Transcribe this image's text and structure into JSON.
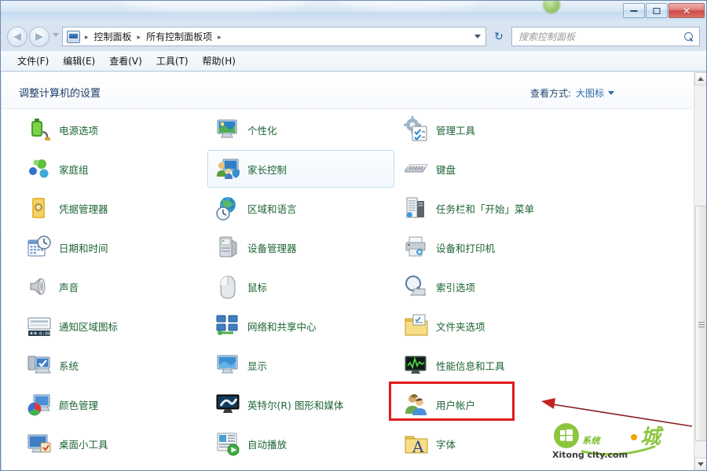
{
  "window": {
    "title": "",
    "buttons": {
      "minimize": "minimize",
      "maximize": "maximize",
      "close": "✕"
    }
  },
  "nav": {
    "back_tooltip": "后退",
    "forward_tooltip": "前进",
    "breadcrumb": [
      "控制面板",
      "所有控制面板项"
    ],
    "separator": "▸",
    "refresh_glyph": "↻",
    "address_icon": "control-panel-icon"
  },
  "search": {
    "placeholder": "搜索控制面板",
    "value": ""
  },
  "menubar": {
    "items": [
      "文件(F)",
      "编辑(E)",
      "查看(V)",
      "工具(T)",
      "帮助(H)"
    ]
  },
  "page": {
    "title": "调整计算机的设置",
    "view_by_label": "查看方式:",
    "view_by_value": "大图标"
  },
  "items": [
    {
      "label": "电源选项",
      "icon": "power-options-icon",
      "col": 0,
      "row": 0,
      "hover": false
    },
    {
      "label": "家庭组",
      "icon": "homegroup-icon",
      "col": 0,
      "row": 1,
      "hover": false
    },
    {
      "label": "凭据管理器",
      "icon": "credential-manager-icon",
      "col": 0,
      "row": 2,
      "hover": false
    },
    {
      "label": "日期和时间",
      "icon": "date-time-icon",
      "col": 0,
      "row": 3,
      "hover": false
    },
    {
      "label": "声音",
      "icon": "sound-icon",
      "col": 0,
      "row": 4,
      "hover": false
    },
    {
      "label": "通知区域图标",
      "icon": "notification-area-icon",
      "col": 0,
      "row": 5,
      "hover": false
    },
    {
      "label": "系统",
      "icon": "system-icon",
      "col": 0,
      "row": 6,
      "hover": false
    },
    {
      "label": "颜色管理",
      "icon": "color-management-icon",
      "col": 0,
      "row": 7,
      "hover": false
    },
    {
      "label": "桌面小工具",
      "icon": "desktop-gadgets-icon",
      "col": 0,
      "row": 8,
      "hover": false
    },
    {
      "label": "个性化",
      "icon": "personalization-icon",
      "col": 1,
      "row": 0,
      "hover": false
    },
    {
      "label": "家长控制",
      "icon": "parental-controls-icon",
      "col": 1,
      "row": 1,
      "hover": true
    },
    {
      "label": "区域和语言",
      "icon": "region-language-icon",
      "col": 1,
      "row": 2,
      "hover": false
    },
    {
      "label": "设备管理器",
      "icon": "device-manager-icon",
      "col": 1,
      "row": 3,
      "hover": false
    },
    {
      "label": "鼠标",
      "icon": "mouse-icon",
      "col": 1,
      "row": 4,
      "hover": false
    },
    {
      "label": "网络和共享中心",
      "icon": "network-sharing-icon",
      "col": 1,
      "row": 5,
      "hover": false
    },
    {
      "label": "显示",
      "icon": "display-icon",
      "col": 1,
      "row": 6,
      "hover": false
    },
    {
      "label": "英特尔(R) 图形和媒体",
      "icon": "intel-graphics-icon",
      "col": 1,
      "row": 7,
      "hover": false
    },
    {
      "label": "自动播放",
      "icon": "autoplay-icon",
      "col": 1,
      "row": 8,
      "hover": false
    },
    {
      "label": "管理工具",
      "icon": "admin-tools-icon",
      "col": 2,
      "row": 0,
      "hover": false
    },
    {
      "label": "键盘",
      "icon": "keyboard-icon",
      "col": 2,
      "row": 1,
      "hover": false
    },
    {
      "label": "任务栏和「开始」菜单",
      "icon": "taskbar-startmenu-icon",
      "col": 2,
      "row": 2,
      "hover": false
    },
    {
      "label": "设备和打印机",
      "icon": "devices-printers-icon",
      "col": 2,
      "row": 3,
      "hover": false
    },
    {
      "label": "索引选项",
      "icon": "indexing-options-icon",
      "col": 2,
      "row": 4,
      "hover": false
    },
    {
      "label": "文件夹选项",
      "icon": "folder-options-icon",
      "col": 2,
      "row": 5,
      "hover": false
    },
    {
      "label": "性能信息和工具",
      "icon": "performance-info-icon",
      "col": 2,
      "row": 6,
      "hover": false
    },
    {
      "label": "用户帐户",
      "icon": "user-accounts-icon",
      "col": 2,
      "row": 7,
      "hover": false
    },
    {
      "label": "字体",
      "icon": "fonts-icon",
      "col": 2,
      "row": 8,
      "hover": false
    }
  ],
  "annotation": {
    "highlight_target": "用户帐户",
    "box_color": "#e01b1b",
    "arrow_color": "#8b1a1a"
  },
  "watermark": {
    "main_text": "系统·城",
    "sub_text": "Xitong city.com",
    "color": "#7cb518"
  }
}
